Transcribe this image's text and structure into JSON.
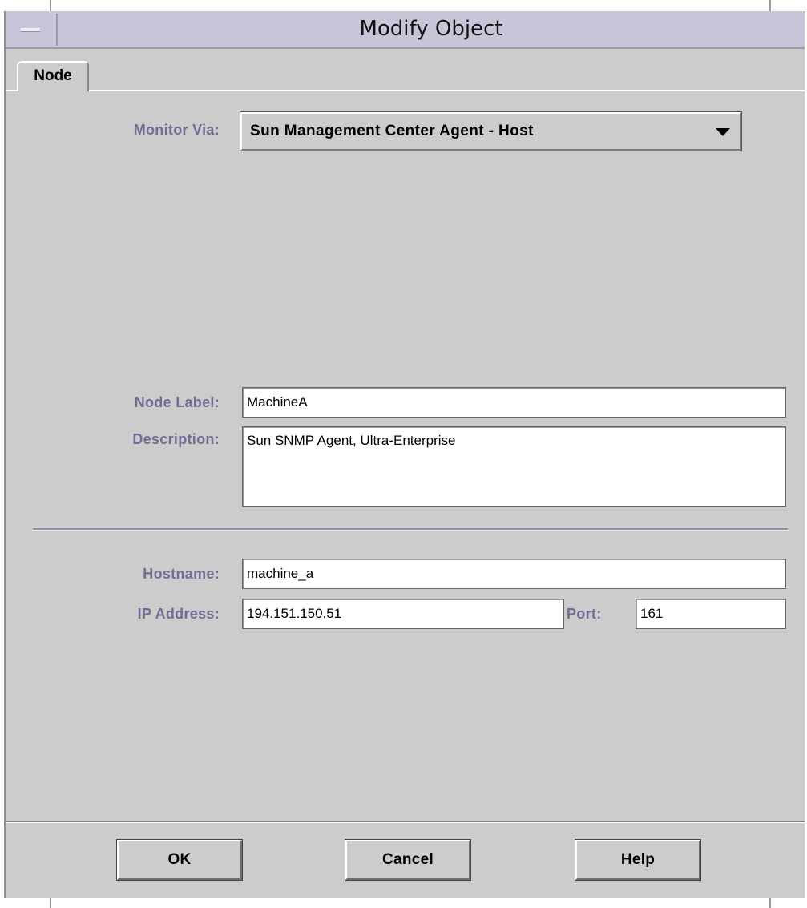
{
  "window": {
    "title": "Modify Object"
  },
  "tabs": [
    {
      "label": "Node",
      "active": true
    }
  ],
  "form": {
    "monitor_via": {
      "label": "Monitor Via:",
      "selected": "Sun Management Center Agent - Host"
    },
    "node_label": {
      "label": "Node Label:",
      "value": "MachineA"
    },
    "description": {
      "label": "Description:",
      "value": "Sun SNMP Agent, Ultra-Enterprise"
    },
    "hostname": {
      "label": "Hostname:",
      "value": "machine_a"
    },
    "ip_address": {
      "label": "IP Address:",
      "value": "194.151.150.51"
    },
    "port": {
      "label": "Port:",
      "value": "161"
    }
  },
  "buttons": {
    "ok": "OK",
    "cancel": "Cancel",
    "help": "Help"
  },
  "colors": {
    "label_text": "#6e6e94",
    "window_bg": "#cccccc",
    "titlebar_bg": "#c6c6d8"
  }
}
